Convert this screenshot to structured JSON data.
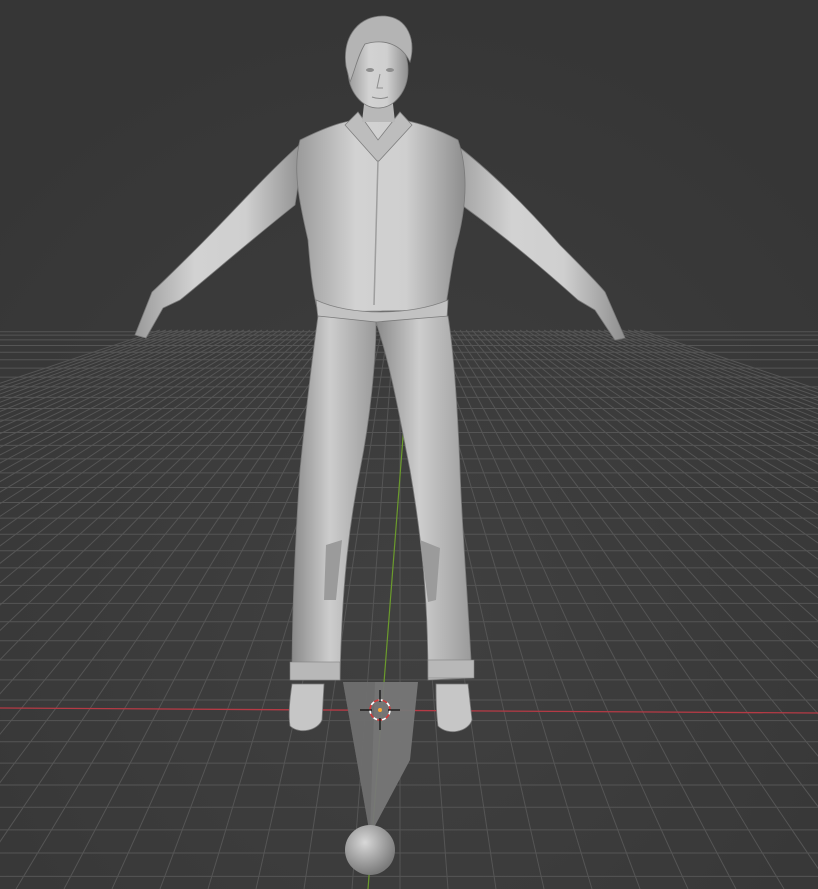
{
  "app": "Blender",
  "viewport": {
    "background_color": "#3b3b3b",
    "grid_color": "#555555",
    "x_axis_color": "#c8414c",
    "y_axis_color": "#6a9a2a",
    "model_color": "#c8c8c8",
    "model_shadow_color": "#8a8a8a"
  },
  "scene_objects": [
    {
      "name": "human-mesh",
      "type": "mesh",
      "pose": "A-pose"
    },
    {
      "name": "3d-cursor",
      "type": "cursor"
    },
    {
      "name": "sphere-empty",
      "type": "mesh"
    },
    {
      "name": "selection-wedge",
      "type": "mesh"
    }
  ]
}
